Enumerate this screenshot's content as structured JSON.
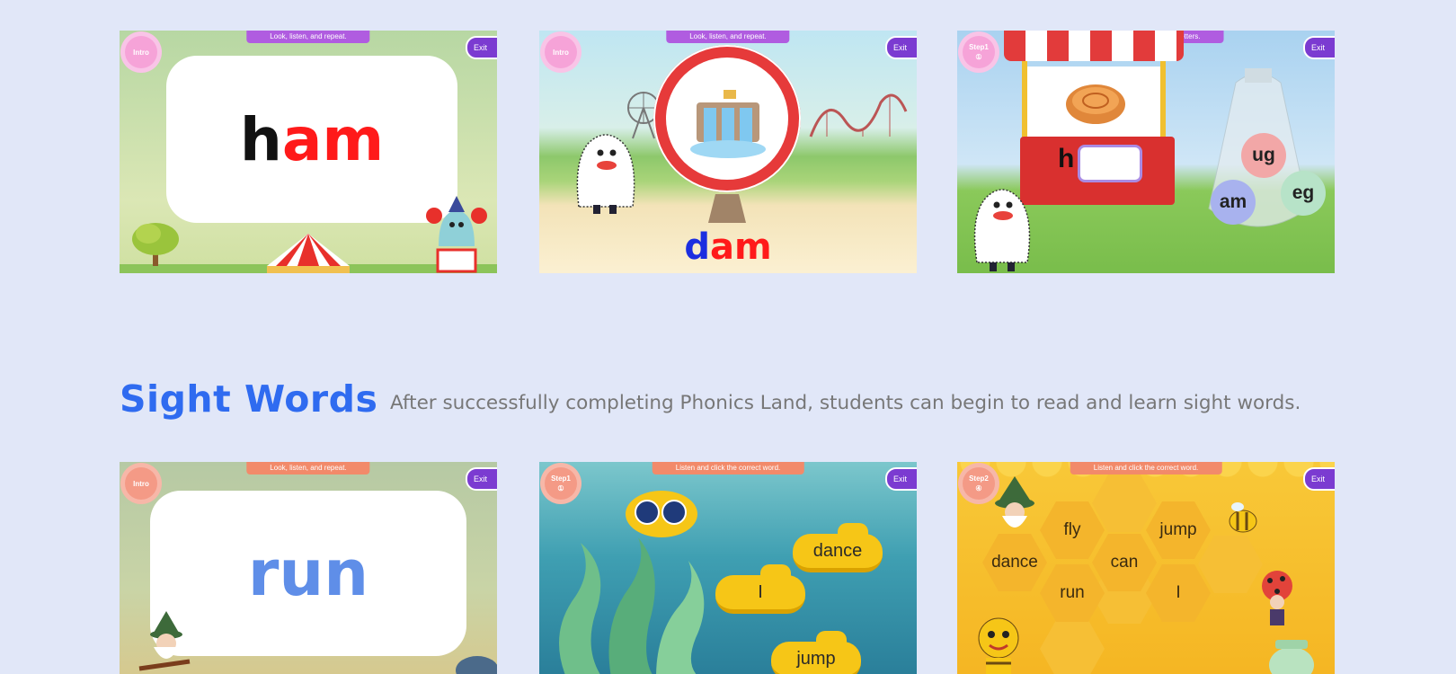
{
  "colors": {
    "page_bg": "#e1e7f8",
    "title_blue": "#2f6bf0",
    "exit_purple": "#7b3bd1",
    "letter_red": "#ff1a1a",
    "letter_blue": "#1c2ee0",
    "word_blue": "#5f8ee8"
  },
  "phonics_cards": [
    {
      "banner": "Look, listen, and repeat.",
      "badge": "Intro",
      "exit": "Exit",
      "word_first": "h",
      "word_rest": "am"
    },
    {
      "banner": "Look, listen, and repeat.",
      "badge": "Intro",
      "exit": "Exit",
      "word_first": "d",
      "word_rest": "am"
    },
    {
      "banner": "Listen and click the correct letters.",
      "badge": "Step1",
      "badge_num": "①",
      "exit": "Exit",
      "prefix": "h",
      "options": [
        "ug",
        "am",
        "eg"
      ]
    }
  ],
  "sight_words": {
    "title": "Sight Words",
    "description": "After successfully completing Phonics Land, students can begin to read and learn sight words."
  },
  "sight_cards": [
    {
      "banner": "Look, listen, and repeat.",
      "badge": "Intro",
      "exit": "Exit",
      "word": "run"
    },
    {
      "banner": "Listen and click the correct word.",
      "badge": "Step1",
      "badge_num": "①",
      "exit": "Exit",
      "words": [
        "dance",
        "I",
        "jump"
      ]
    },
    {
      "banner": "Listen and click the correct word.",
      "badge": "Step2",
      "badge_num": "④",
      "exit": "Exit",
      "words": [
        "fly",
        "jump",
        "dance",
        "can",
        "run",
        "I"
      ]
    }
  ],
  "icons": [
    "sun-badge-icon",
    "exit-icon",
    "tree-icon",
    "circus-tent-icon",
    "ghost-character-icon",
    "clown-icon",
    "waterfall-dam-icon",
    "pie-icon",
    "bag-icon",
    "submarine-icon",
    "seaweed-icon",
    "bee-icon",
    "honey-jar-icon",
    "gnome-icon",
    "ladybug-icon"
  ]
}
